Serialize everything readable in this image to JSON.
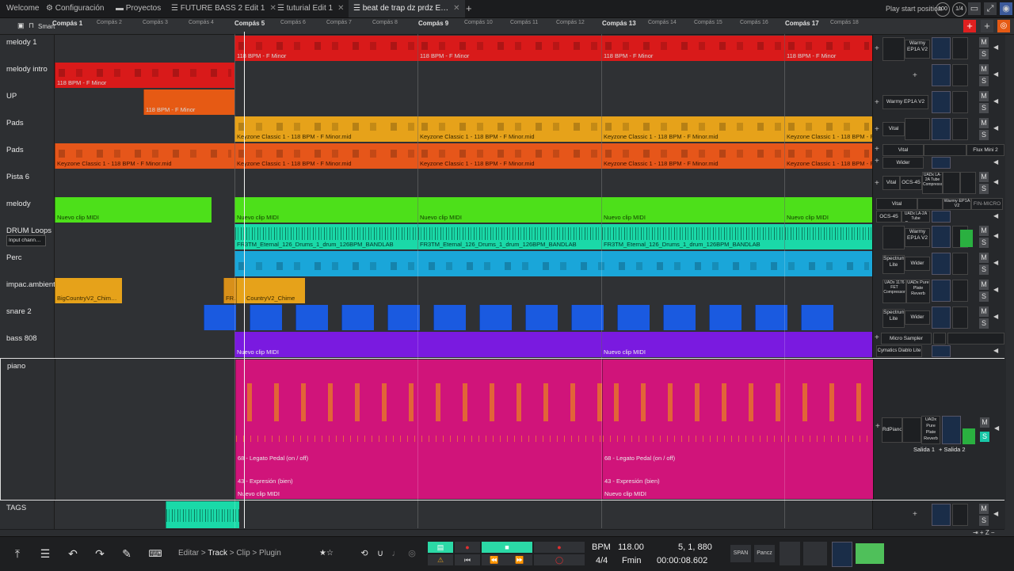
{
  "tabs": {
    "welcome": "Welcome",
    "config": "Configuración",
    "projects": "Proyectos",
    "future": "FUTURE BASS 2 Edit 1",
    "tutorial": "tuturial Edit 1",
    "beat": "beat de trap dz prdz E…"
  },
  "topright": {
    "play_start": "Play start position",
    "zoom": "100",
    "beat_marker": "1/4"
  },
  "ruler": {
    "smart": "Smart",
    "marks": {
      "c1": "Compás 1",
      "c2": "Compás 2",
      "c3": "Compás 3",
      "c4": "Compás 4",
      "c5": "Compás 5",
      "c6": "Compás 6",
      "c7": "Compás 7",
      "c8": "Compás 8",
      "c9": "Compás 9",
      "c10": "Compás 10",
      "c11": "Compás 11",
      "c12": "Compás 12",
      "c13": "Compás 13",
      "c14": "Compás 14",
      "c15": "Compás 15",
      "c16": "Compás 16",
      "c17": "Compás 17",
      "c18": "Compás 18"
    }
  },
  "tracks": {
    "melody1": {
      "name": "melody 1",
      "clip": "118 BPM - F Minor",
      "plugin": "Warmy EP1A V2",
      "color": "#d91a1a"
    },
    "melodyintro": {
      "name": "melody intro",
      "clip": "118 BPM - F Minor",
      "color": "#d91a1a"
    },
    "up": {
      "name": "UP",
      "clip": "118 BPM - F Minor",
      "plugin": "Warmy EP1A V2",
      "color": "#e65a14"
    },
    "pads1": {
      "name": "Pads",
      "clip": "Keyzone Classic 1 - 118 BPM - F Minor.mid",
      "plugin": "Vital",
      "color": "#e6a21a"
    },
    "pads2": {
      "name": "Pads",
      "clip": "Keyzone Classic 1 - 118 BPM - F Minor.mid",
      "plugin": "Vital",
      "plugin2": "Flux Mini 2",
      "plugin3": "Wider",
      "color": "#e6561a"
    },
    "pista6": {
      "name": "Pista 6",
      "plugin": "Vital",
      "plugin2": "OCS-45",
      "plugin3": "UADx LA-2A Tube Compressor"
    },
    "melody": {
      "name": "melody",
      "clip": "Nuevo clip MIDI",
      "plugin": "Vital",
      "plugin2": "OCS-45",
      "plugin3": "Warmy EP1A V2",
      "plugin4": "FIN-MICRO",
      "plugin5": "UADx LA-2A Tube Compressor",
      "color": "#4de01a"
    },
    "drum": {
      "name": "DRUM Loops",
      "input": "Input chann…",
      "clip": "FR3TM_Eternal_126_Drums_1_drum_126BPM_BANDLAB",
      "plugin": "Warmy EP1A V2",
      "color": "#1ad9a8"
    },
    "perc": {
      "name": "Perc",
      "plugin": "Spectrum Lite",
      "plugin2": "Wider",
      "color": "#1aa6d9"
    },
    "impac": {
      "name": "impac.ambient",
      "clip": "BigCountryV2_Chim…",
      "clip2": "FR…",
      "clip3": "CountryV2_Chime",
      "plugin": "UADx 1176 FET Compressor",
      "plugin2": "UADx Pure Plate Reverb",
      "color": "#e6a21a"
    },
    "snare": {
      "name": "snare 2",
      "plugin": "Spectrum Lite",
      "plugin2": "Wider",
      "color": "#1a5ae0"
    },
    "bass": {
      "name": "bass 808",
      "clip": "Nuevo clip MIDI",
      "plugin": "Micro Sampler",
      "plugin2": "Cymatics Diablo Lite",
      "color": "#7a1ae0"
    },
    "piano": {
      "name": "piano",
      "clip": "Nuevo clip MIDI",
      "auto1": "68 - Legato Pedal (on / off)",
      "auto2": "43 - Expresión (bien)",
      "plugin": "RdPiano",
      "plugin2": "UADx Pure Plate Reverb",
      "out1": "Salida 1",
      "out2": "+ Salida 2",
      "color": "#d0147a"
    },
    "tags": {
      "name": "TAGS",
      "color": "#1ad9a8"
    }
  },
  "ms": {
    "m": "M",
    "s": "S"
  },
  "bottom": {
    "crumb1": "Editar",
    "crumb2": "Track",
    "crumb3": "Clip",
    "crumb4": "Plugin",
    "sep": ">",
    "bpm_label": "BPM",
    "bpm": "118.00",
    "sig": "4/4",
    "key": "Fmin",
    "position": "5, 1, 880",
    "time": "00:00:08.602",
    "span": "SPAN",
    "pancz": "Pancz"
  }
}
